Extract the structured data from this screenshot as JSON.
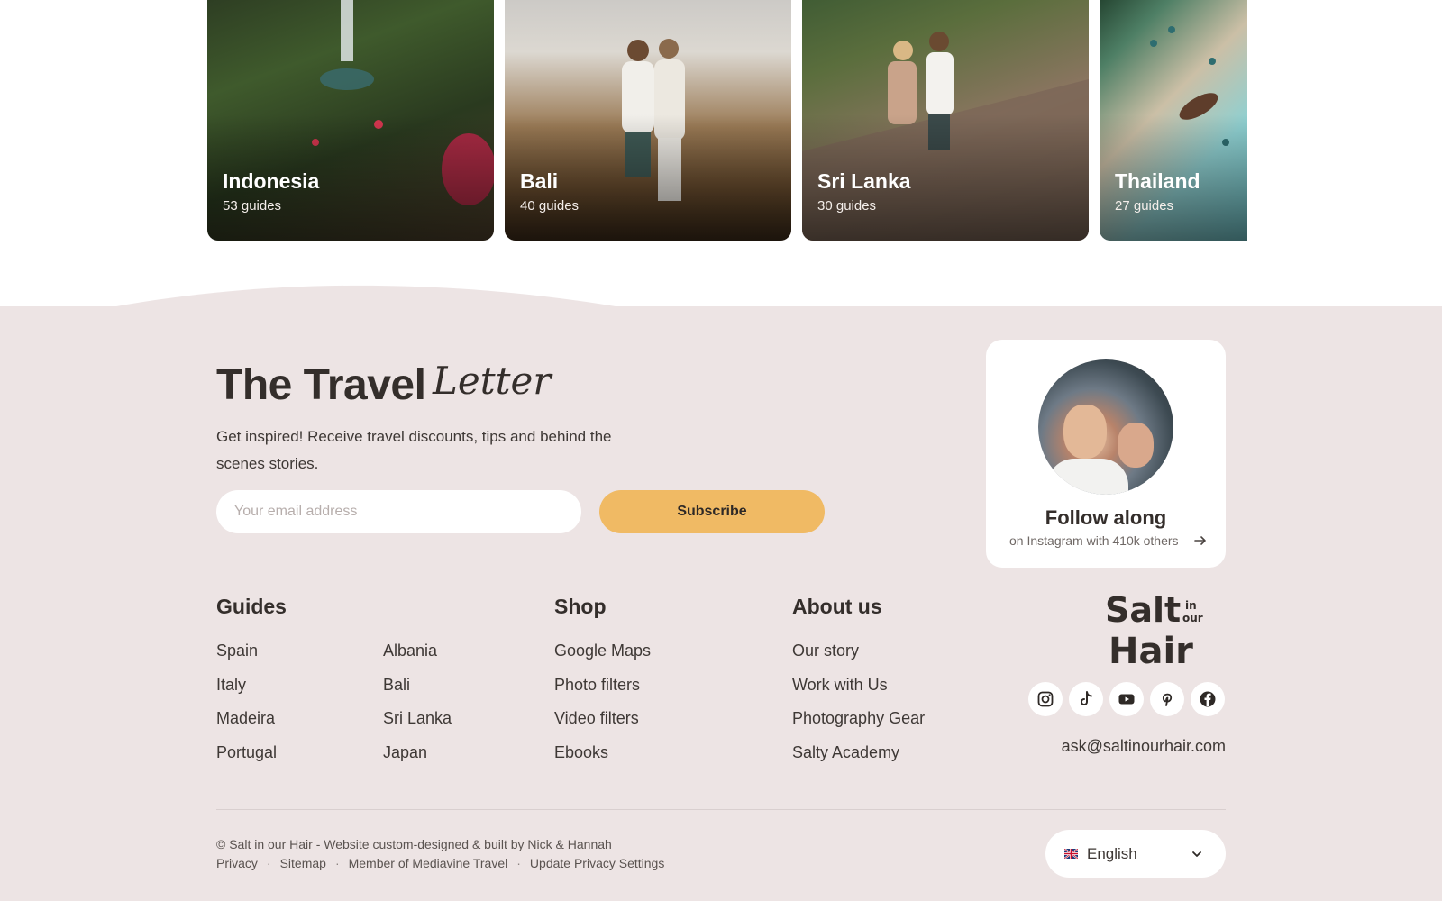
{
  "destinations": [
    {
      "title": "Indonesia",
      "count": "53 guides"
    },
    {
      "title": "Bali",
      "count": "40 guides"
    },
    {
      "title": "Sri Lanka",
      "count": "30 guides"
    },
    {
      "title": "Thailand",
      "count": "27 guides"
    }
  ],
  "newsletter": {
    "title": "The Travel",
    "script_word": "Letter",
    "description": "Get inspired! Receive travel discounts, tips and behind the scenes stories.",
    "email_placeholder": "Your email address",
    "subscribe_label": "Subscribe"
  },
  "follow": {
    "title": "Follow along",
    "subtitle": "on Instagram with 410k others"
  },
  "guides": {
    "heading": "Guides",
    "col1": [
      "Spain",
      "Italy",
      "Madeira",
      "Portugal"
    ],
    "col2": [
      "Albania",
      "Bali",
      "Sri Lanka",
      "Japan"
    ]
  },
  "shop": {
    "heading": "Shop",
    "links": [
      "Google Maps",
      "Photo filters",
      "Video filters",
      "Ebooks"
    ]
  },
  "about": {
    "heading": "About us",
    "links": [
      "Our story",
      "Work with Us",
      "Photography Gear",
      "Salty Academy"
    ]
  },
  "brand": {
    "logo_words": [
      "Salt",
      "in",
      "our",
      "Hair"
    ]
  },
  "socials": [
    "instagram-icon",
    "tiktok-icon",
    "youtube-icon",
    "pinterest-icon",
    "facebook-icon"
  ],
  "contact_email": "ask@saltinourhair.com",
  "footer": {
    "copyright": "© Salt in our Hair - Website custom-designed & built by Nick & Hannah",
    "privacy": "Privacy",
    "sitemap": "Sitemap",
    "member": "Member of Mediavine Travel",
    "update_privacy": "Update Privacy Settings",
    "separator": "·"
  },
  "language": {
    "selected": "English"
  },
  "colors": {
    "footer_bg": "#ede4e4",
    "accent": "#f0ba64",
    "text": "#342e2b"
  }
}
